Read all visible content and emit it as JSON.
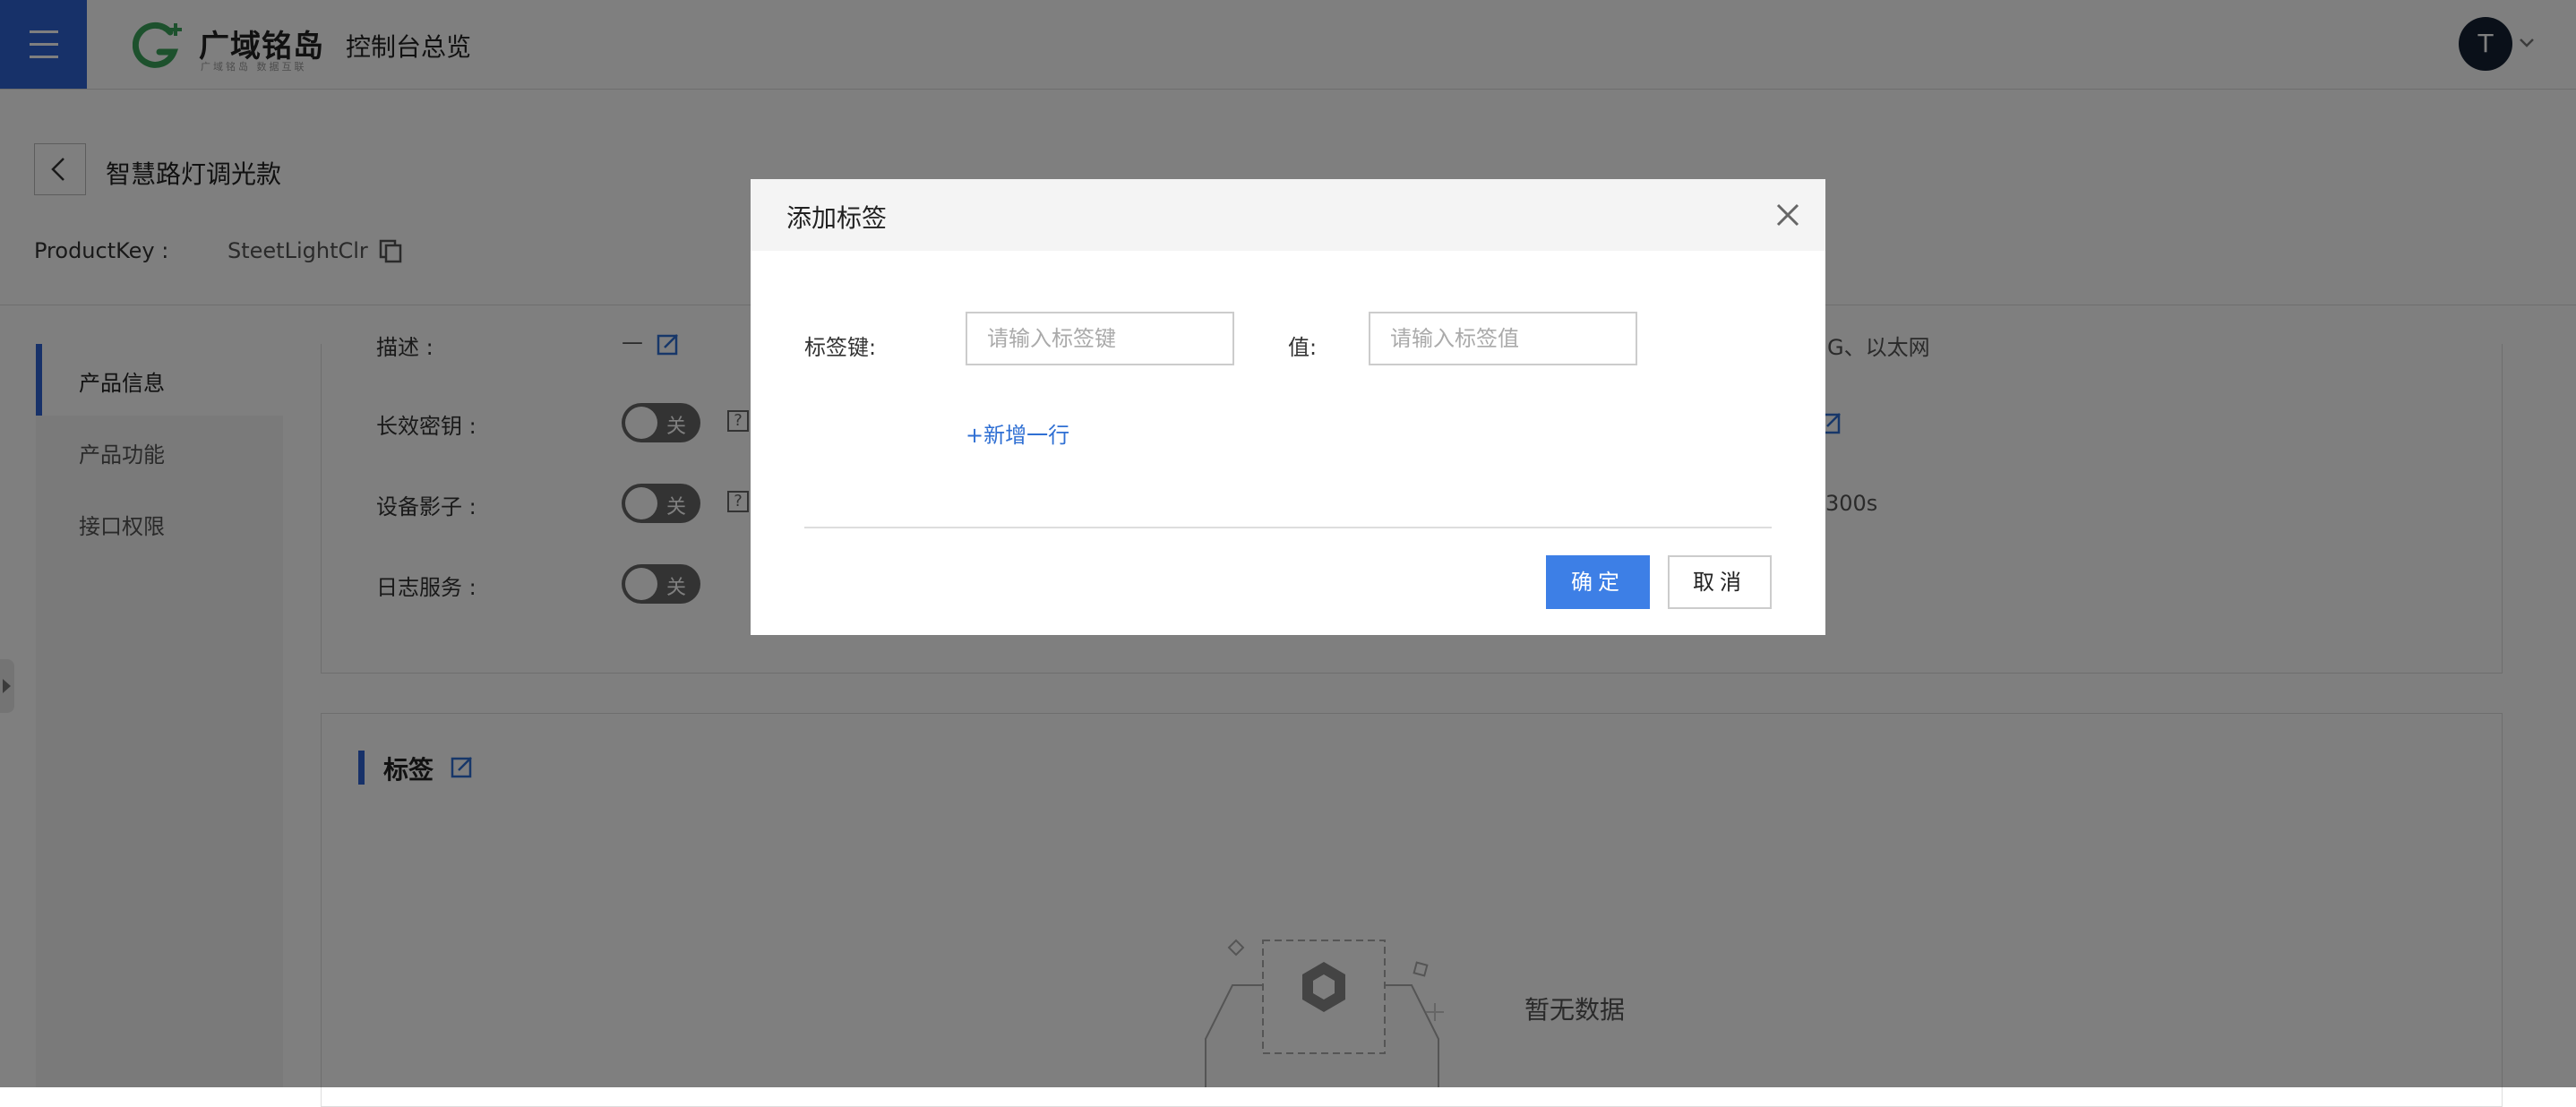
{
  "app": {
    "logo_text": "广域铭岛",
    "logo_tagline": "广域铭岛 数据互联",
    "console_title": "控制台总览",
    "user_initial": "T"
  },
  "product": {
    "name": "智慧路灯调光款",
    "key_label": "ProductKey :",
    "key_value": "SteetLightClr"
  },
  "side_menu": {
    "items": [
      {
        "label": "产品信息",
        "active": true
      },
      {
        "label": "产品功能",
        "active": false
      },
      {
        "label": "接口权限",
        "active": false
      }
    ]
  },
  "info_panel": {
    "desc_label": "描述 :",
    "desc_value": "—",
    "fields": [
      {
        "label": "长效密钥 :",
        "toggle": "关"
      },
      {
        "label": "设备影子 :",
        "toggle": "关"
      },
      {
        "label": "日志服务 :",
        "toggle": "关"
      }
    ],
    "right_partial_1": "G、以太网",
    "right_partial_2": "300s"
  },
  "tags_panel": {
    "title": "标签",
    "empty_text": "暂无数据"
  },
  "modal": {
    "title": "添加标签",
    "key_label": "标签键:",
    "key_placeholder": "请输入标签键",
    "value_label": "值:",
    "value_placeholder": "请输入标签值",
    "add_row": "+新增一行",
    "ok_label": "确定",
    "cancel_label": "取消"
  },
  "colors": {
    "primary": "#2f62d3",
    "button_blue": "#3d7fe6",
    "link_blue": "#2f6fd3",
    "logo_green": "#3aa35a"
  }
}
